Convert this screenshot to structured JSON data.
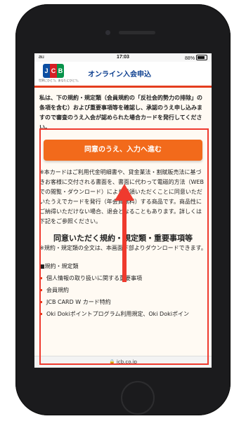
{
  "status": {
    "carrier": "au",
    "time": "17:03",
    "battery": "88%"
  },
  "header": {
    "logo_text": "JCB",
    "logo_tagline": "世界にひとつ。あなたにひとつ。",
    "title": "オンライン入会申込"
  },
  "content": {
    "intro": "私は、下の規約・規定類（会員規約の「反社会的勢力の排除」の条項を含む）および重要事項等を確認し、承認のうえ申し込みますので審査のうえ入会が認められた場合カードを発行してください。",
    "agree_button": "同意のうえ、入力へ進む",
    "note": "※本カードはご利用代金明細書や、貸金業法・割賦販売法に基づきお客様に交付される書面を、書面に代わって電磁的方法（WEBでの閲覧・ダウンロード）により受領いただくことに同意いただいたうえでカードを発行（年会費無料）する商品です。商品性にご納得いただけない場合、退会となることもあります。詳しくは下記をご参照ください。",
    "terms_heading": "同意いただく規約・規定類・重要事項等",
    "terms_sub": "※規約・規定類の全文は、本画面下部よりダウンロードできます。",
    "list_heading": "■規約・規定類",
    "terms_items": [
      "個人情報の取り扱いに関する重要事項",
      "会員規約",
      "JCB CARD W カード特約",
      "Oki Dokiポイントプログラム利用規定、Oki Dokiポイン"
    ]
  },
  "browser": {
    "url": "jcb.co.jp"
  },
  "colors": {
    "accent": "#f26a1b",
    "annotation": "#ef3a2e",
    "brand_blue": "#0a3d8f"
  }
}
